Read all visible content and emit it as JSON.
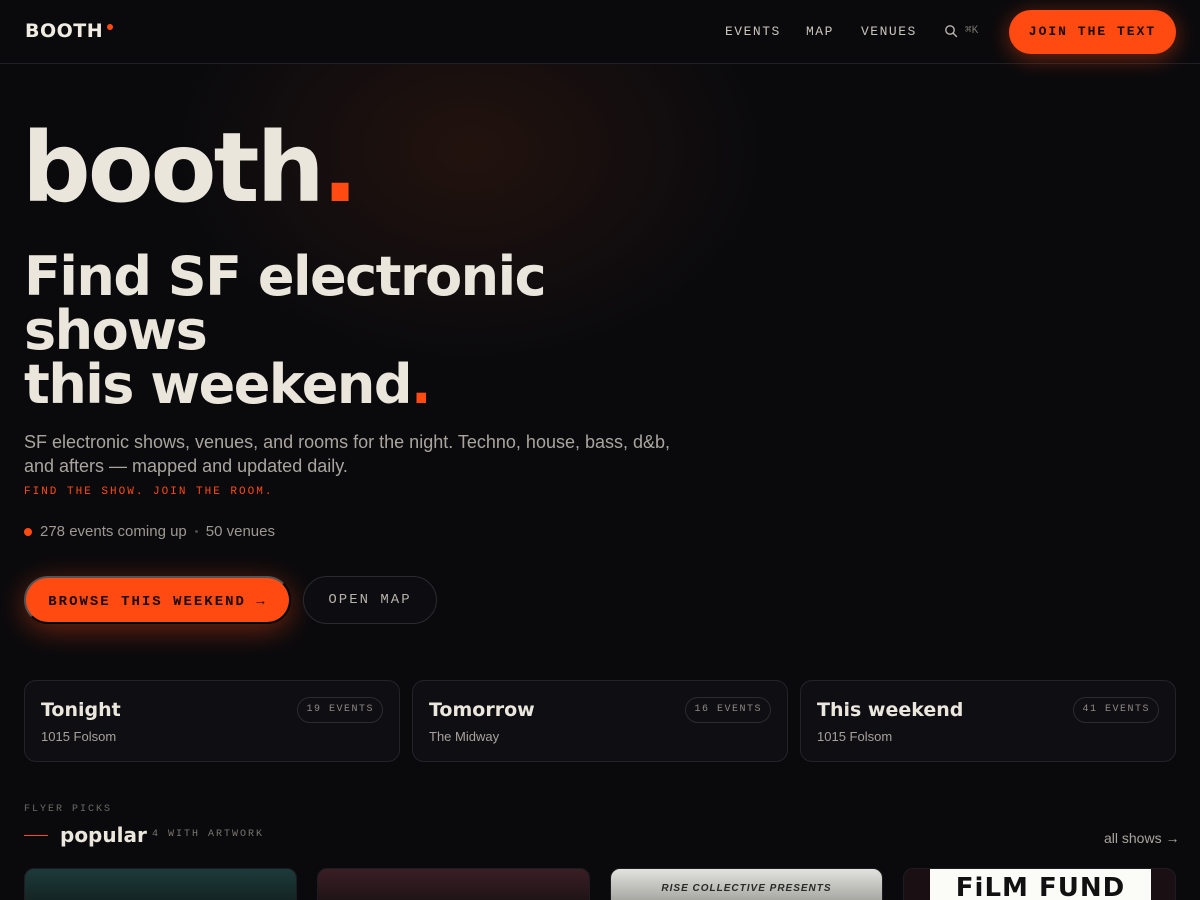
{
  "nav": {
    "logo": "BOOTH",
    "links": [
      "EVENTS",
      "MAP",
      "VENUES"
    ],
    "search_shortcut": "⌘K",
    "cta": "JOIN THE TEXT"
  },
  "hero": {
    "wordmark": "booth",
    "wordmark_dot": ".",
    "headline_line1": "Find SF electronic",
    "headline_line2": "shows",
    "headline_line3": "this weekend",
    "headline_dot": ".",
    "lede": "SF electronic shows, venues, and rooms for the night. Techno, house, bass, d&b, and afters — mapped and updated daily.",
    "tagline": "FIND THE SHOW. JOIN THE ROOM.",
    "stat_events": "278 events coming up",
    "stat_venues": "50 venues",
    "primary_cta": "BROWSE THIS WEEKEND →",
    "secondary_cta": "OPEN MAP"
  },
  "cards": [
    {
      "title": "Tonight",
      "venue": "1015 Folsom",
      "badge": "19 EVENTS"
    },
    {
      "title": "Tomorrow",
      "venue": "The Midway",
      "badge": "16 EVENTS"
    },
    {
      "title": "This weekend",
      "venue": "1015 Folsom",
      "badge": "41 EVENTS"
    }
  ],
  "section": {
    "eyebrow": "FLYER PICKS",
    "title": "popular",
    "count": "4 WITH ARTWORK",
    "all_link": "all shows →"
  },
  "flyers": {
    "flyer3_text": "RISE COLLECTIVE PRESENTS",
    "flyer4_text": "FiLM FUND"
  },
  "colors": {
    "accent": "#ff4a12",
    "background": "#0a0a0d",
    "text": "#ebe6dc"
  }
}
